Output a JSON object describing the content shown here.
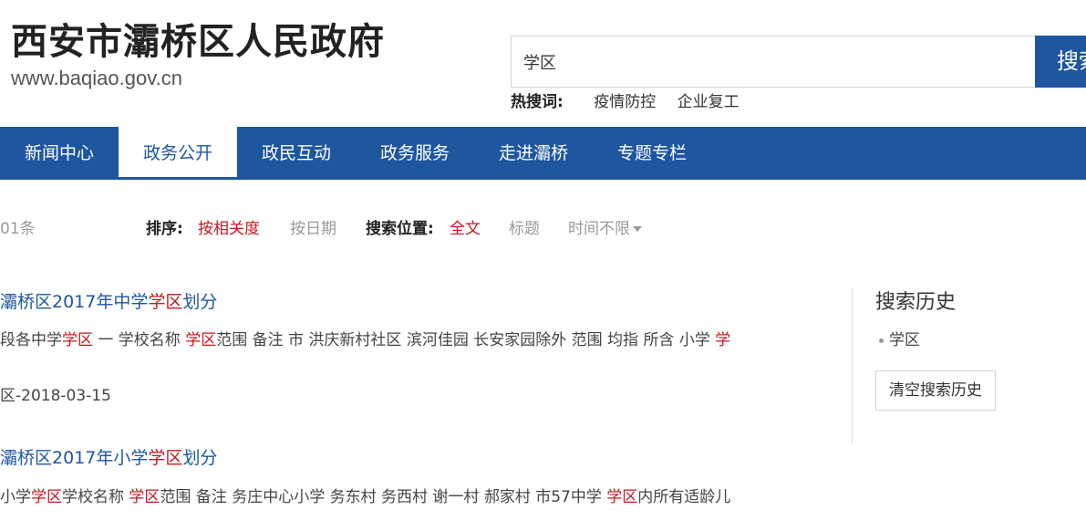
{
  "header": {
    "site_title": "西安市灞桥区人民政府",
    "site_url": "www.baqiao.gov.cn"
  },
  "search": {
    "value": "学区",
    "button_label": "搜索"
  },
  "hotwords": {
    "label": "热搜词:",
    "items": [
      "疫情防控",
      "企业复工"
    ]
  },
  "nav": {
    "items": [
      {
        "label": "新闻中心",
        "active": false
      },
      {
        "label": "政务公开",
        "active": true
      },
      {
        "label": "政民互动",
        "active": false
      },
      {
        "label": "政务服务",
        "active": false
      },
      {
        "label": "走进灞桥",
        "active": false
      },
      {
        "label": "专题专栏",
        "active": false
      }
    ]
  },
  "toolbar": {
    "result_count": "01条",
    "sort_label": "排序:",
    "sort_relevance": "按相关度",
    "sort_date": "按日期",
    "position_label": "搜索位置:",
    "position_full": "全文",
    "position_title": "标题",
    "time_filter": "时间不限"
  },
  "results": [
    {
      "title_pre": "灞桥区2017年中学",
      "title_hl": "学区",
      "title_post": "划分",
      "snippet": [
        {
          "t": "段各中学",
          "h": false
        },
        {
          "t": "学区",
          "h": true
        },
        {
          "t": " 一 学校名称 ",
          "h": false
        },
        {
          "t": "学区",
          "h": true
        },
        {
          "t": "范围 备注 市 洪庆新村社区 滨河佳园 长安家园除外 范围 均指 所含 小学 ",
          "h": false
        },
        {
          "t": "学",
          "h": true
        }
      ],
      "meta": "区-2018-03-15"
    },
    {
      "title_pre": "灞桥区2017年小学",
      "title_hl": "学区",
      "title_post": "划分",
      "snippet": [
        {
          "t": "小学",
          "h": false
        },
        {
          "t": "学区",
          "h": true
        },
        {
          "t": "学校名称 ",
          "h": false
        },
        {
          "t": "学区",
          "h": true
        },
        {
          "t": "范围 备注 务庄中心小学 务东村 务西村 谢一村 郝家村 市57中学 ",
          "h": false
        },
        {
          "t": "学区",
          "h": true
        },
        {
          "t": "内所有适龄儿",
          "h": false
        }
      ]
    }
  ],
  "sidebar": {
    "history_title": "搜索历史",
    "history_items": [
      "学区"
    ],
    "clear_label": "清空搜索历史"
  },
  "colors": {
    "brand_blue": "#1e56a0",
    "highlight_red": "#c8161e"
  }
}
